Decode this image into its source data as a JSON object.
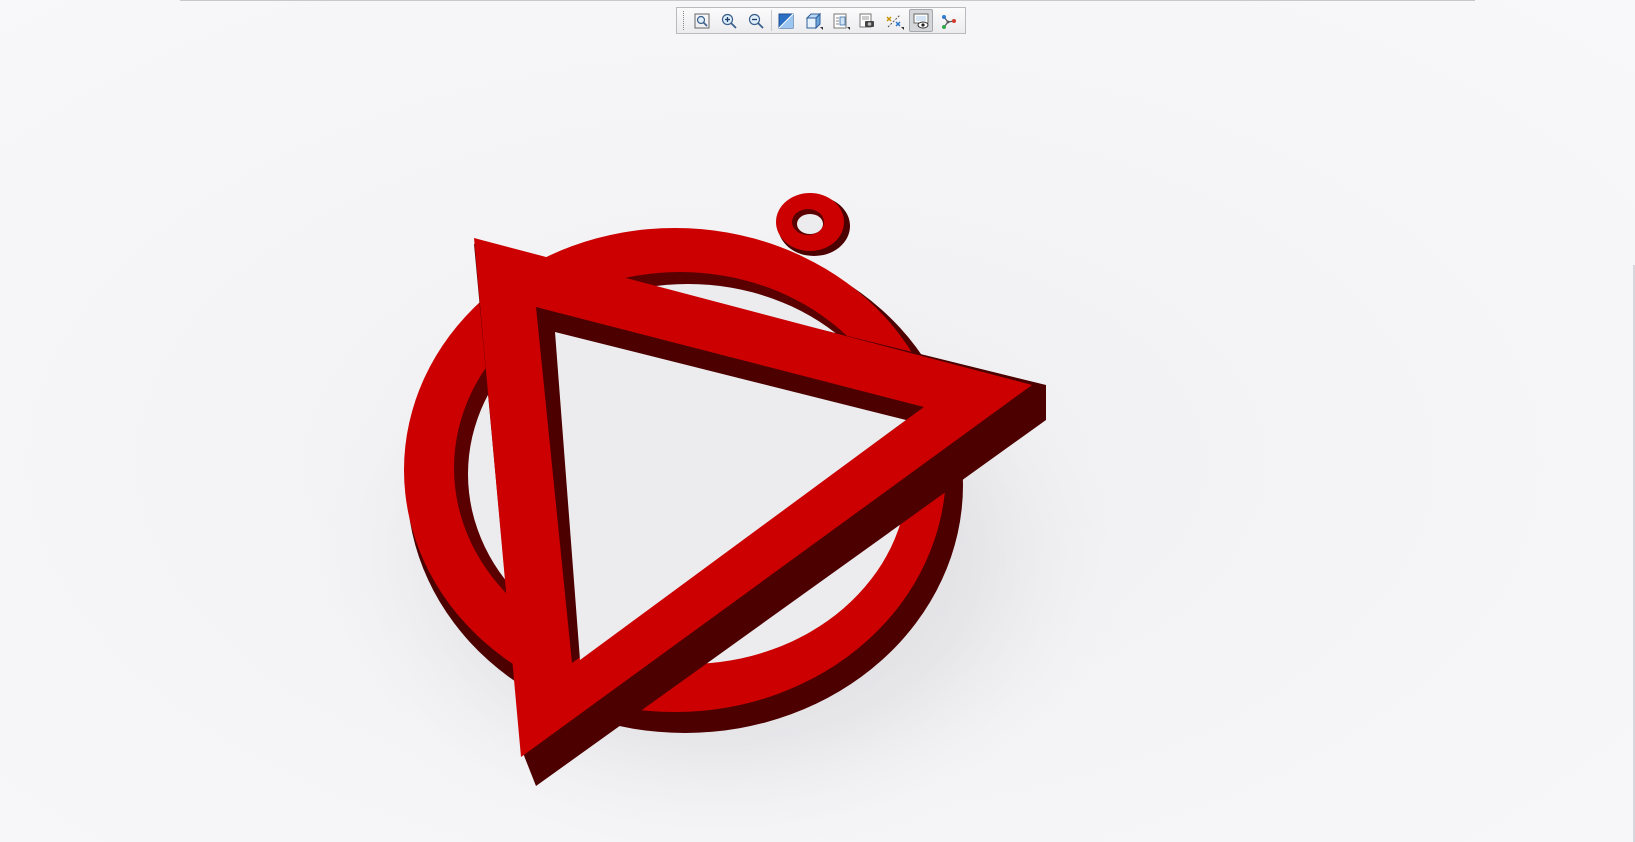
{
  "viewer": {
    "background": "#f6f6f8",
    "model_color": "#cc0000",
    "model_shade_color": "#4d0000"
  },
  "toolbar": {
    "buttons": [
      {
        "icon": "zoom-fit-icon",
        "active": false,
        "dropdown": false
      },
      {
        "icon": "zoom-in-icon",
        "active": false,
        "dropdown": false
      },
      {
        "icon": "zoom-out-icon",
        "active": false,
        "dropdown": false
      },
      {
        "icon": "shading-icon",
        "active": false,
        "dropdown": false
      },
      {
        "icon": "view-cube-icon",
        "active": false,
        "dropdown": true
      },
      {
        "icon": "view-list-icon",
        "active": false,
        "dropdown": true
      },
      {
        "icon": "screenshot-icon",
        "active": false,
        "dropdown": false
      },
      {
        "icon": "axis-display-icon",
        "active": false,
        "dropdown": true
      },
      {
        "icon": "visibility-icon",
        "active": true,
        "dropdown": false
      },
      {
        "icon": "structure-tree-icon",
        "active": false,
        "dropdown": false
      }
    ]
  }
}
